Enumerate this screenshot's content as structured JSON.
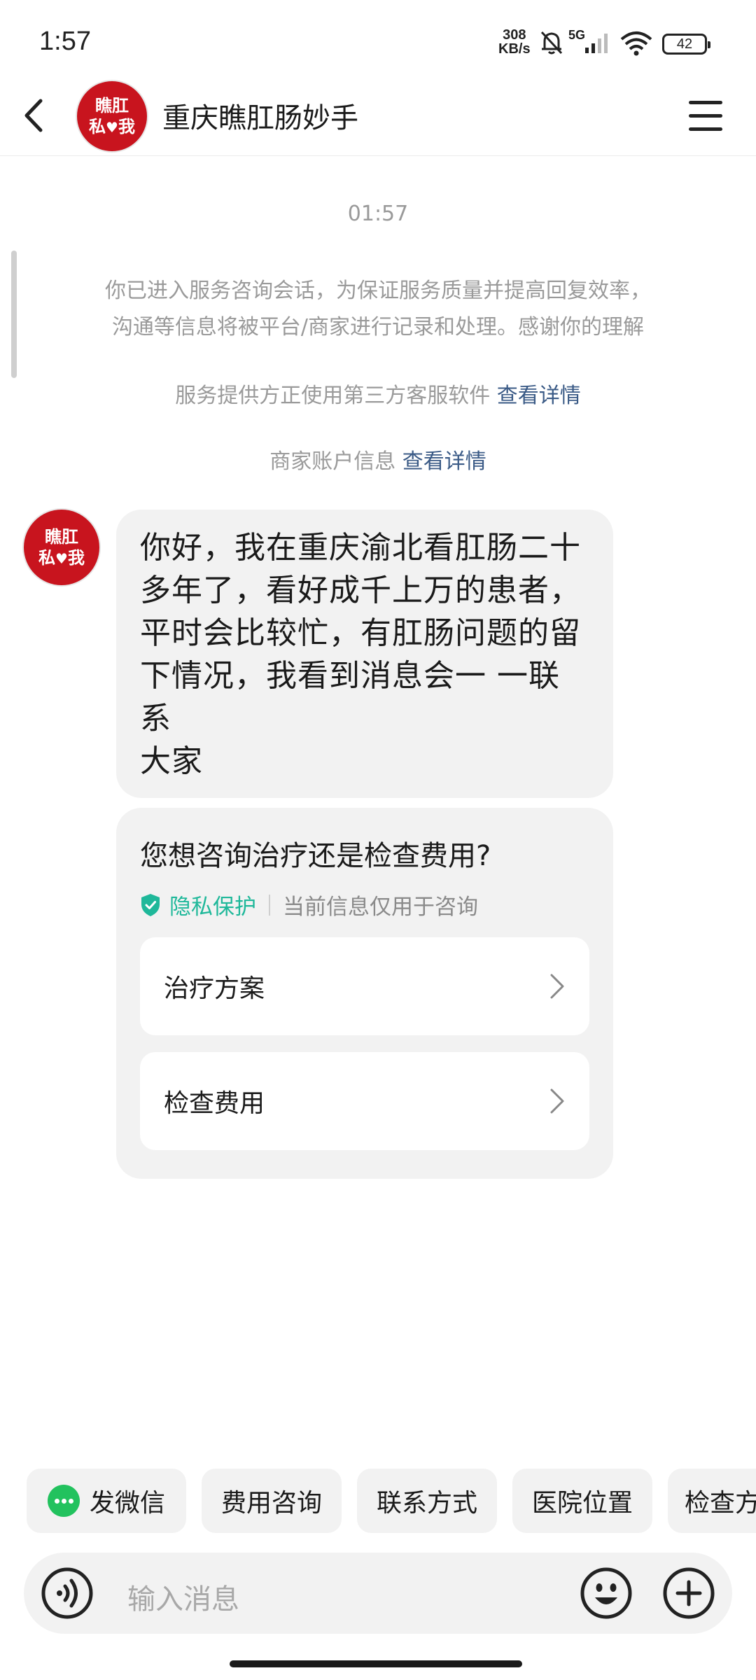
{
  "status_bar": {
    "time": "1:57",
    "net_speed_value": "308",
    "net_speed_unit": "KB/s",
    "signal": "5G",
    "battery": "42"
  },
  "header": {
    "title": "重庆瞧肛肠妙手",
    "avatar_line1": "瞧肛",
    "avatar_line2_a": "私",
    "avatar_line2_b": "我",
    "avatar_heart": "♥"
  },
  "chat": {
    "timestamp": "01:57",
    "notice_line1": "你已进入服务咨询会话，为保证服务质量并提高回复效率，",
    "notice_line2": "沟通等信息将被平台/商家进行记录和处理。感谢你的理解",
    "third_party_text": "服务提供方正使用第三方客服软件",
    "third_party_link": "查看详情",
    "merchant_text": "商家账户信息",
    "merchant_link": "查看详情",
    "message_lines": [
      "你好，我在重庆渝北看肛肠二十",
      "多年了，看好成千上万的患者，",
      "平时会比较忙，有肛肠问题的留",
      "下情况，我看到消息会一 一联系",
      "大家"
    ],
    "card": {
      "question": "您想咨询治疗还是检查费用?",
      "privacy_label": "隐私保护",
      "privacy_desc": "当前信息仅用于咨询",
      "options": [
        "治疗方案",
        "检查费用"
      ]
    }
  },
  "quick_replies": [
    "发微信",
    "费用咨询",
    "联系方式",
    "医院位置",
    "检查方"
  ],
  "input": {
    "placeholder": "输入消息"
  }
}
